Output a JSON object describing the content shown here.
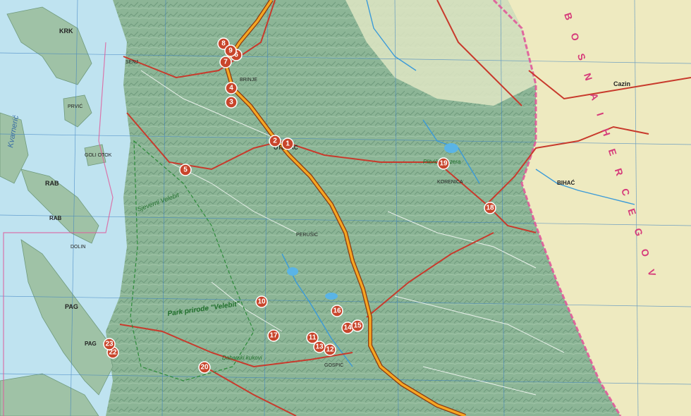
{
  "labels": {
    "island_krk": "KRK",
    "island_rab": "RAB",
    "island_pag": "PAG",
    "town_rab": "RAB",
    "town_pag": "PAG",
    "town_otocac": "OTOČAC",
    "town_cazin": "Cazin",
    "town_bihac": "BIHAĆ",
    "park_velebit": "Park prirode \"Velebit\"",
    "park_sjeverni_velebit": "Sjeverni Velebit",
    "park_plitvice": "Plitvička jezera",
    "dabarski_kukovi": "Dabarski kukovi",
    "sea_name": "Kvarnerić",
    "country_letters": "B O S N A  I  H E R C E G O V",
    "poi_labels": [
      "PRVIĆ",
      "GOLI OTOK",
      "DOLIN",
      "BRINJE",
      "PERUŠIĆ",
      "GOSPIĆ",
      "KORENICA",
      "SENJ"
    ]
  },
  "colors": {
    "sea": "#bfe3f0",
    "land_croatia": "#8fb79a",
    "land_bosnia": "#eeeac0",
    "highway": "#f5a623",
    "road_red": "#c83a2c",
    "border": "#e05a9a",
    "grid": "#3a7fc0",
    "marker": "#c8452b"
  },
  "markers": [
    {
      "n": "1"
    },
    {
      "n": "2"
    },
    {
      "n": "3"
    },
    {
      "n": "4"
    },
    {
      "n": "5"
    },
    {
      "n": "6"
    },
    {
      "n": "7"
    },
    {
      "n": "8"
    },
    {
      "n": "9"
    },
    {
      "n": "10"
    },
    {
      "n": "11"
    },
    {
      "n": "12"
    },
    {
      "n": "13"
    },
    {
      "n": "14"
    },
    {
      "n": "15"
    },
    {
      "n": "16"
    },
    {
      "n": "17"
    },
    {
      "n": "18"
    },
    {
      "n": "19"
    },
    {
      "n": "20"
    },
    {
      "n": "22"
    },
    {
      "n": "23"
    }
  ]
}
